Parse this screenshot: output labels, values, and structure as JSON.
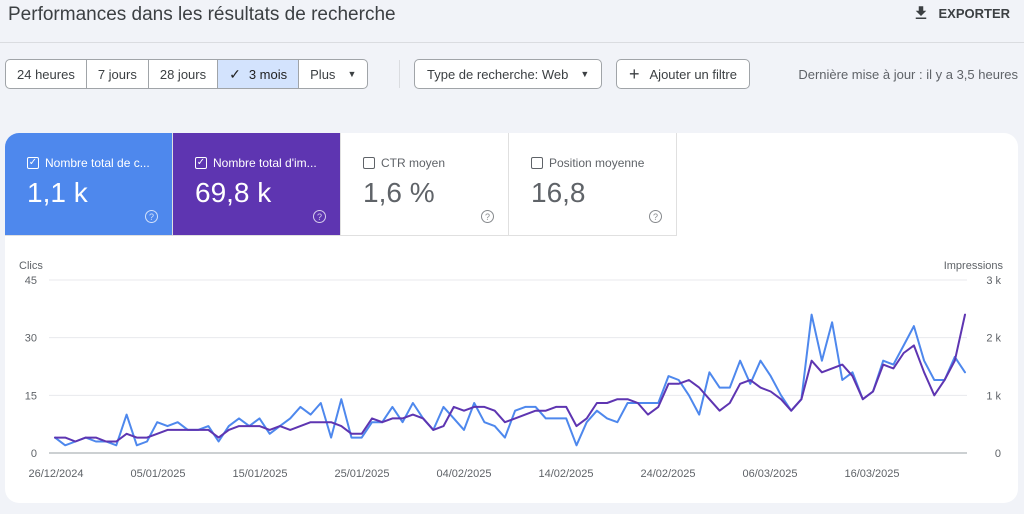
{
  "header": {
    "title": "Performances dans les résultats de recherche",
    "export_label": "EXPORTER"
  },
  "filters": {
    "ranges": [
      {
        "label": "24 heures",
        "active": false
      },
      {
        "label": "7 jours",
        "active": false
      },
      {
        "label": "28 jours",
        "active": false
      },
      {
        "label": "3 mois",
        "active": true
      },
      {
        "label": "Plus",
        "active": false
      }
    ],
    "search_type": "Type de recherche: Web",
    "add_filter": "Ajouter un filtre",
    "last_update": "Dernière mise à jour : il y a 3,5 heures"
  },
  "metrics": [
    {
      "label": "Nombre total de c...",
      "value": "1,1 k",
      "checked": true,
      "color": "#4e88ed"
    },
    {
      "label": "Nombre total d'im...",
      "value": "69,8 k",
      "checked": true,
      "color": "#5e35b1"
    },
    {
      "label": "CTR moyen",
      "value": "1,6 %",
      "checked": false,
      "color": "#ffffff"
    },
    {
      "label": "Position moyenne",
      "value": "16,8",
      "checked": false,
      "color": "#ffffff"
    }
  ],
  "chart_data": {
    "type": "line",
    "left_axis": {
      "label": "Clics",
      "range": [
        0,
        45
      ],
      "ticks": [
        "0",
        "15",
        "30",
        "45"
      ]
    },
    "right_axis": {
      "label": "Impressions",
      "range": [
        0,
        3000
      ],
      "ticks": [
        "0",
        "1 k",
        "2 k",
        "3 k"
      ]
    },
    "x_tick_labels": [
      "26/12/2024",
      "05/01/2025",
      "15/01/2025",
      "25/01/2025",
      "04/02/2025",
      "14/02/2025",
      "24/02/2025",
      "06/03/2025",
      "16/03/2025"
    ],
    "grid": true,
    "series": [
      {
        "name": "Clics",
        "axis": "left",
        "color": "#4e88ed",
        "values": [
          4,
          2,
          3,
          4,
          3,
          3,
          2,
          10,
          2,
          3,
          8,
          7,
          8,
          6,
          6,
          7,
          3,
          7,
          9,
          7,
          9,
          5,
          7,
          9,
          12,
          10,
          13,
          4,
          14,
          4,
          4,
          8,
          8,
          12,
          8,
          13,
          9,
          6,
          12,
          9,
          6,
          13,
          8,
          7,
          4,
          11,
          12,
          12,
          9,
          9,
          9,
          2,
          8,
          11,
          9,
          8,
          13,
          13,
          13,
          13,
          20,
          19,
          15,
          10,
          21,
          17,
          17,
          24,
          18,
          24,
          20,
          15,
          11,
          14,
          36,
          24,
          34,
          19,
          21,
          14,
          16,
          24,
          23,
          28,
          33,
          24,
          19,
          19,
          25,
          21
        ]
      },
      {
        "name": "Impressions",
        "axis": "left",
        "color": "#5e35b1",
        "values": [
          4,
          4,
          3,
          4,
          4,
          3,
          3,
          5,
          4,
          4,
          5,
          6,
          6,
          6,
          6,
          6,
          4,
          6,
          7,
          7,
          7,
          6,
          7,
          6,
          7,
          8,
          8,
          8,
          7,
          5,
          5,
          9,
          8,
          9,
          9,
          10,
          9,
          6,
          7,
          12,
          11,
          12,
          12,
          11,
          8,
          9,
          10,
          11,
          11,
          12,
          12,
          7,
          9,
          13,
          13,
          14,
          14,
          13,
          10,
          12,
          18,
          18,
          19,
          17,
          14,
          11,
          13,
          18,
          19,
          17,
          16,
          14,
          11,
          14,
          24,
          21,
          22,
          23,
          20,
          14,
          16,
          23,
          22,
          26,
          28,
          21,
          15,
          19,
          24,
          36
        ]
      }
    ]
  }
}
